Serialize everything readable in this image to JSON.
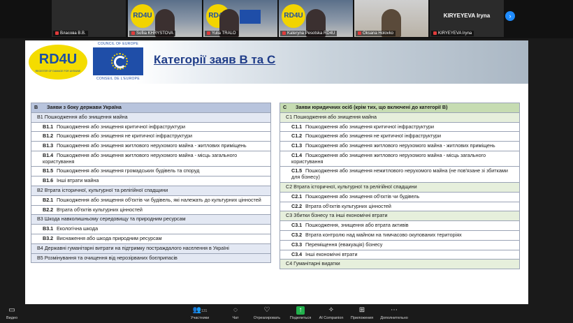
{
  "participants": [
    {
      "name": "Власова В.В.",
      "kind": "video"
    },
    {
      "name": "Sofiia KHRYSTOVA",
      "kind": "video"
    },
    {
      "name": "Yulia TRALO",
      "kind": "video"
    },
    {
      "name": "Kateryna Pesotska RD4U",
      "kind": "video"
    },
    {
      "name": "Oksana Holovko",
      "kind": "video"
    },
    {
      "name": "KIRYEYEVA Iryna",
      "kind": "name",
      "label": "KIRYEYEVA Iryna"
    }
  ],
  "next_label": "›",
  "slide": {
    "rd4u_logo": "RD4U",
    "rd4u_sub": "REGISTER OF DAMAGE FOR UKRAINE",
    "coe_top": "COUNCIL OF EUROPE",
    "coe_bottom": "CONSEIL DE L'EUROPE",
    "title": "Категорії заяв В та С",
    "table_b": {
      "code": "B",
      "header": "Заяви з боку держави Україна",
      "rows": [
        {
          "level": 1,
          "code": "",
          "text": "B1 Пошкодження або знищення майна"
        },
        {
          "level": 2,
          "code": "B1.1",
          "text": "Пошкодження або знищення критичної інфраструктури"
        },
        {
          "level": 2,
          "code": "B1.2",
          "text": "Пошкодження або знищення не критичної інфраструктури"
        },
        {
          "level": 2,
          "code": "B1.3",
          "text": "Пошкодження або знищення житлового нерухомого майна - житлових приміщень"
        },
        {
          "level": 2,
          "code": "B1.4",
          "text": "Пошкодження або знищення житлового нерухомого майна - місць загального користування"
        },
        {
          "level": 2,
          "code": "B1.5",
          "text": "Пошкодження або знищення громадських будівель та споруд"
        },
        {
          "level": 2,
          "code": "B1.6",
          "text": "Інші втрати майна"
        },
        {
          "level": 1,
          "code": "",
          "text": "B2 Втрата історичної, культурної та релігійної спадщини"
        },
        {
          "level": 2,
          "code": "B2.1",
          "text": "Пошкодження або знищення об'єктів чи будівель, які належать до культурних цінностей"
        },
        {
          "level": 2,
          "code": "B2.2",
          "text": "Втрата об'єктів культурних цінностей"
        },
        {
          "level": 1,
          "code": "",
          "text": "B3 Шкода навколишньому середовищу та природним ресурсам"
        },
        {
          "level": 2,
          "code": "B3.1",
          "text": "Екологічна шкода"
        },
        {
          "level": 2,
          "code": "B3.2",
          "text": "Виснаження або шкода природним ресурсам"
        },
        {
          "level": 1,
          "code": "",
          "text": "B4 Державні гуманітарні витрати на підтримку постраждалого населення в Україні"
        },
        {
          "level": 1,
          "code": "",
          "text": "B5 Розмінування та очищення від нерозірваних боєприпасів"
        }
      ]
    },
    "table_c": {
      "code": "C",
      "header": "Заяви юридичних осіб (крім тих, що включені до категорії В)",
      "rows": [
        {
          "level": 1,
          "code": "",
          "text": "C1 Пошкодження або знищення майна"
        },
        {
          "level": 2,
          "code": "C1.1",
          "text": "Пошкодження або знищення критичної інфраструктури"
        },
        {
          "level": 2,
          "code": "C1.2",
          "text": "Пошкодження або знищення не критичної інфраструктури"
        },
        {
          "level": 2,
          "code": "C1.3",
          "text": "Пошкодження або знищення житлового нерухомого майна - житлових приміщень"
        },
        {
          "level": 2,
          "code": "C1.4",
          "text": "Пошкодження або знищення житлового нерухомого майна - місць загального користування"
        },
        {
          "level": 2,
          "code": "C1.5",
          "text": "Пошкодження або знищення нежитлового нерухомого майна (не пов'язане зі збитками для бізнесу)"
        },
        {
          "level": 1,
          "code": "",
          "text": "C2 Втрата історичної, культурної та релігійної спадщини"
        },
        {
          "level": 2,
          "code": "C2.1",
          "text": "Пошкодження або знищення об'єктів чи будівель"
        },
        {
          "level": 2,
          "code": "C2.2",
          "text": "Втрата об'єктів культурних цінностей"
        },
        {
          "level": 1,
          "code": "",
          "text": "C3 Збитки бізнесу та інші економічні втрати"
        },
        {
          "level": 2,
          "code": "C3.1",
          "text": "Пошкодження, знищення або втрата активів"
        },
        {
          "level": 2,
          "code": "C3.2",
          "text": "Втрата контролю над майном на тимчасово окупованих територіях"
        },
        {
          "level": 2,
          "code": "C3.3",
          "text": "Переміщення (евакуація) бізнесу"
        },
        {
          "level": 2,
          "code": "C3.4",
          "text": "Інші економічні втрати"
        },
        {
          "level": 1,
          "code": "",
          "text": "C4 Гуманітарні видатки"
        }
      ]
    }
  },
  "toolbar": {
    "video": "Видео",
    "participants": "Участники",
    "participants_count": "131",
    "chat": "Чат",
    "react": "Отреагировать",
    "share": "Поделиться",
    "ai": "AI Companion",
    "apps": "Приложения",
    "more": "Дополнительно"
  },
  "colors": {
    "b_header": "#b8c4dd",
    "c_header": "#c6dcb2",
    "title": "#1f3c88",
    "share": "#22b14c"
  }
}
